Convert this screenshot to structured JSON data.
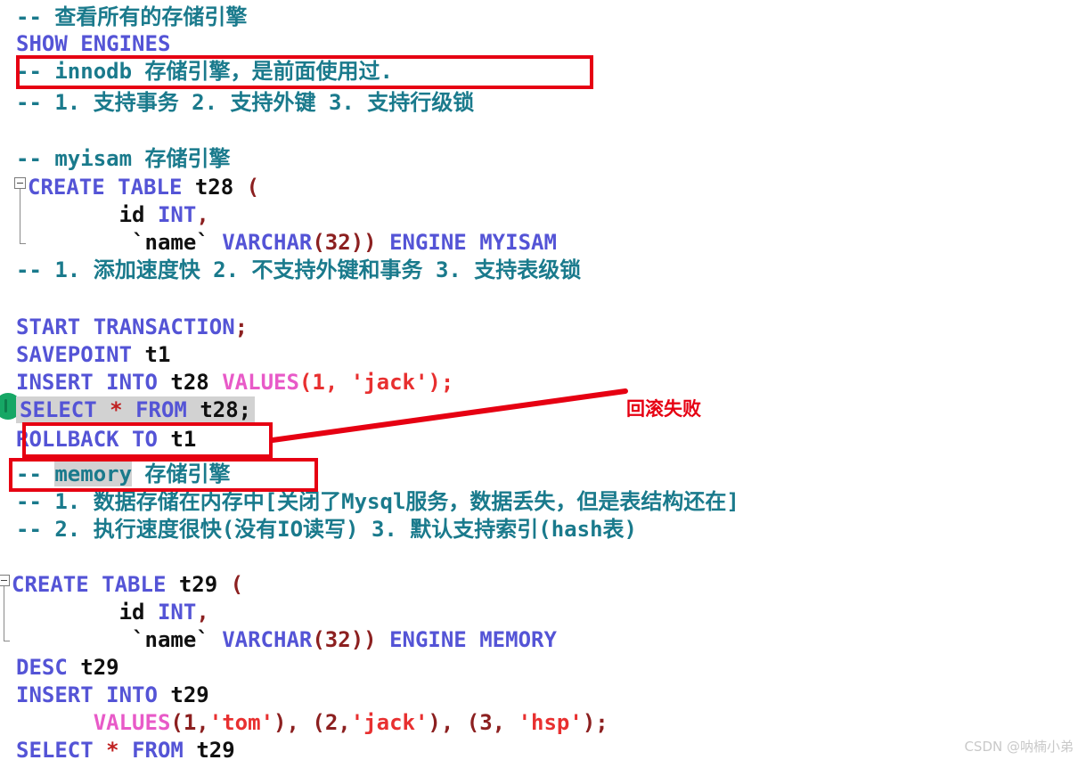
{
  "editor": {
    "language": "sql",
    "colors": {
      "background": "#ffffff",
      "comment": "#1a7a8c",
      "keyword": "#5454d6",
      "identifier": "#101010",
      "string": "#e83030",
      "punctuation": "#8c2020",
      "function": "#e85ac8",
      "selection": "#d2d2d2",
      "annotation": "#e60012",
      "run_marker": "#16a765"
    },
    "lines": [
      {
        "id": "l1",
        "text": "-- 查看所有的存储引擎"
      },
      {
        "id": "l2",
        "text": "SHOW ENGINES"
      },
      {
        "id": "l3",
        "text": "-- innodb 存储引擎，是前面使用过."
      },
      {
        "id": "l4",
        "text": "-- 1. 支持事务 2. 支持外键 3. 支持行级锁"
      },
      {
        "id": "l5",
        "text": ""
      },
      {
        "id": "l6",
        "text": "-- myisam 存储引擎"
      },
      {
        "id": "l7",
        "text": "CREATE TABLE t28 ("
      },
      {
        "id": "l8",
        "text": "        id INT,"
      },
      {
        "id": "l9",
        "text": "        `name` VARCHAR(32)) ENGINE MYISAM"
      },
      {
        "id": "l10",
        "text": "-- 1. 添加速度快 2. 不支持外键和事务 3. 支持表级锁"
      },
      {
        "id": "l11",
        "text": ""
      },
      {
        "id": "l12",
        "text": "START TRANSACTION;"
      },
      {
        "id": "l13",
        "text": "SAVEPOINT t1"
      },
      {
        "id": "l14",
        "text": "INSERT INTO t28 VALUES(1, 'jack');"
      },
      {
        "id": "l15",
        "text": "SELECT * FROM t28;"
      },
      {
        "id": "l16",
        "text": "ROLLBACK TO t1"
      },
      {
        "id": "l17",
        "text": "-- memory 存储引擎"
      },
      {
        "id": "l18",
        "text": "-- 1. 数据存储在内存中[关闭了Mysql服务，数据丢失，但是表结构还在]"
      },
      {
        "id": "l19",
        "text": "-- 2. 执行速度很快(没有IO读写) 3. 默认支持索引(hash表)"
      },
      {
        "id": "l20",
        "text": ""
      },
      {
        "id": "l21",
        "text": "CREATE TABLE t29 ("
      },
      {
        "id": "l22",
        "text": "        id INT,"
      },
      {
        "id": "l23",
        "text": "        `name` VARCHAR(32)) ENGINE MEMORY"
      },
      {
        "id": "l24",
        "text": "DESC t29"
      },
      {
        "id": "l25",
        "text": "INSERT INTO t29"
      },
      {
        "id": "l26",
        "text": "      VALUES(1,'tom'), (2,'jack'), (3, 'hsp');"
      },
      {
        "id": "l27",
        "text": "SELECT * FROM t29"
      }
    ],
    "tokens": {
      "comment_title_1": "-- 查看所有的存储引擎",
      "show": "SHOW",
      "engines": "ENGINES",
      "comment_innodb_dashes": "-- ",
      "comment_innodb_name": "innodb",
      "comment_innodb_rest": " 存储引擎，是前面使用过.",
      "comment_innodb_features": "-- 1. 支持事务 2. 支持外键 3. 支持行级锁",
      "comment_myisam": "-- myisam 存储引擎",
      "create": "CREATE",
      "table": "TABLE",
      "t28": "t28",
      "t29": "t29",
      "paren_open": "(",
      "id_col": "id",
      "int_type": "INT",
      "comma": ",",
      "name_col": "`name`",
      "varchar": "VARCHAR",
      "size32": "(32))",
      "engine": "ENGINE",
      "myisam": "MYISAM",
      "memory_engine": "MEMORY",
      "comment_myisam_features": "-- 1. 添加速度快 2. 不支持外键和事务 3. 支持表级锁",
      "start": "START",
      "transaction": "TRANSACTION",
      "semicolon": ";",
      "savepoint": "SAVEPOINT",
      "t1": "t1",
      "insert": "INSERT",
      "into": "INTO",
      "values": "VALUES",
      "values_jack": "(1, 'jack');",
      "select": "SELECT",
      "star": "*",
      "from": "FROM",
      "t28_semi": "t28;",
      "rollback": "ROLLBACK",
      "to": "TO",
      "comment_memory_dashes": "-- ",
      "comment_memory_name": "memory",
      "comment_memory_rest": " 存储引擎",
      "comment_memory_1": "-- 1. 数据存储在内存中[关闭了Mysql服务，数据丢失，但是表结构还在]",
      "comment_memory_2": "-- 2. 执行速度很快(没有IO读写) 3. 默认支持索引(hash表)",
      "desc": "DESC",
      "values_rows_p1": "(1,",
      "values_rows_tom": "'tom'",
      "values_rows_p2": "), (2,",
      "values_rows_jack": "'jack'",
      "values_rows_p3": "), (3, ",
      "values_rows_hsp": "'hsp'",
      "values_rows_p4": ");"
    }
  },
  "annotations": {
    "boxes": [
      {
        "id": "box-innodb",
        "target": "-- innodb 存储引擎，是前面使用过."
      },
      {
        "id": "box-rollback",
        "target": "ROLLBACK TO t1"
      },
      {
        "id": "box-memory",
        "target": "-- memory 存储引擎"
      }
    ],
    "callout_label": "回滚失败",
    "color": "#e60012"
  },
  "markers": {
    "run_marker_line": "SELECT * FROM t28;",
    "selected_line": "SELECT * FROM t28;",
    "selected_word": "memory"
  },
  "watermark": {
    "text": "CSDN @呐楠小弟"
  }
}
